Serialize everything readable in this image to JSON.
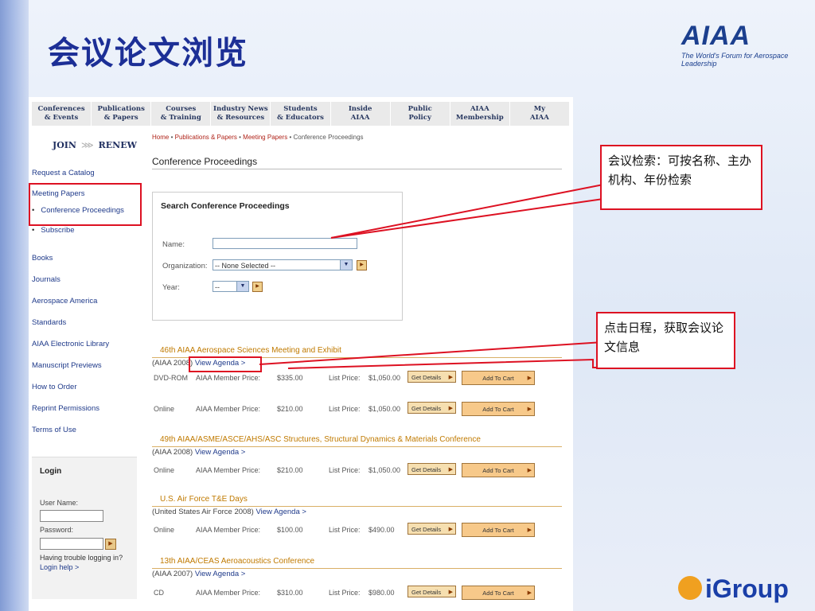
{
  "slide": {
    "title": "会议论文浏览",
    "logo_text": "AIAA",
    "logo_tagline": "The World's Forum for Aerospace Leadership",
    "footer_logo": "iGroup"
  },
  "site": {
    "nav": [
      "Conferences\n& Events",
      "Publications\n& Papers",
      "Courses\n& Training",
      "Industry News\n& Resources",
      "Students\n& Educators",
      "Inside\nAIAA",
      "Public\nPolicy",
      "AIAA\nMembership",
      "My\nAIAA"
    ],
    "join": "JOIN",
    "renew": "RENEW",
    "sidebar": {
      "request_catalog": "Request a Catalog",
      "meeting_papers": "Meeting Papers",
      "conference_proceedings": "Conference Proceedings",
      "subscribe": "Subscribe",
      "books": "Books",
      "journals": "Journals",
      "aerospace_america": "Aerospace America",
      "standards": "Standards",
      "electronic_library": "AIAA Electronic Library",
      "manuscript_previews": "Manuscript Previews",
      "how_to_order": "How to Order",
      "reprint_permissions": "Reprint Permissions",
      "terms_of_use": "Terms of Use"
    },
    "login": {
      "title": "Login",
      "user_label": "User Name:",
      "password_label": "Password:",
      "help_text": "Having trouble logging in?",
      "help_link": "Login help >"
    },
    "breadcrumb": {
      "home": "Home",
      "publications": "Publications & Papers",
      "meeting_papers": "Meeting Papers",
      "current": "Conference Proceedings",
      "sep": "•"
    },
    "page_title": "Conference Proceedings",
    "search": {
      "title": "Search Conference Proceedings",
      "name_label": "Name:",
      "name_value": "",
      "org_label": "Organization:",
      "org_value": "-- None Selected --",
      "year_label": "Year:",
      "year_value": "--"
    },
    "labels": {
      "member_price": "AIAA Member Price:",
      "list_price": "List Price:",
      "get_details": "Get Details",
      "add_to_cart": "Add To Cart",
      "view_agenda": "View Agenda >"
    },
    "conferences": [
      {
        "title": "46th AIAA Aerospace Sciences Meeting and Exhibit",
        "source": "(AIAA 2008)",
        "rows": [
          {
            "format": "DVD-ROM",
            "member": "$335.00",
            "list": "$1,050.00"
          },
          {
            "format": "Online",
            "member": "$210.00",
            "list": "$1,050.00"
          }
        ]
      },
      {
        "title": "49th AIAA/ASME/ASCE/AHS/ASC Structures, Structural Dynamics & Materials Conference",
        "source": "(AIAA 2008)",
        "rows": [
          {
            "format": "Online",
            "member": "$210.00",
            "list": "$1,050.00"
          }
        ]
      },
      {
        "title": "U.S. Air Force T&E Days",
        "source": "(United States Air Force 2008)",
        "rows": [
          {
            "format": "Online",
            "member": "$100.00",
            "list": "$490.00"
          }
        ]
      },
      {
        "title": "13th AIAA/CEAS Aeroacoustics Conference",
        "source": "(AIAA 2007)",
        "rows": [
          {
            "format": "CD",
            "member": "$310.00",
            "list": "$980.00"
          }
        ]
      }
    ]
  },
  "callouts": {
    "search_note": "会议检索：可按名称、主办机构、年份检索",
    "agenda_note": "点击日程，获取会议论文信息"
  },
  "colors": {
    "title": "#1c2f96",
    "highlight": "#dd1122",
    "conference_title": "#c07a00",
    "link": "#1f3a8a"
  }
}
